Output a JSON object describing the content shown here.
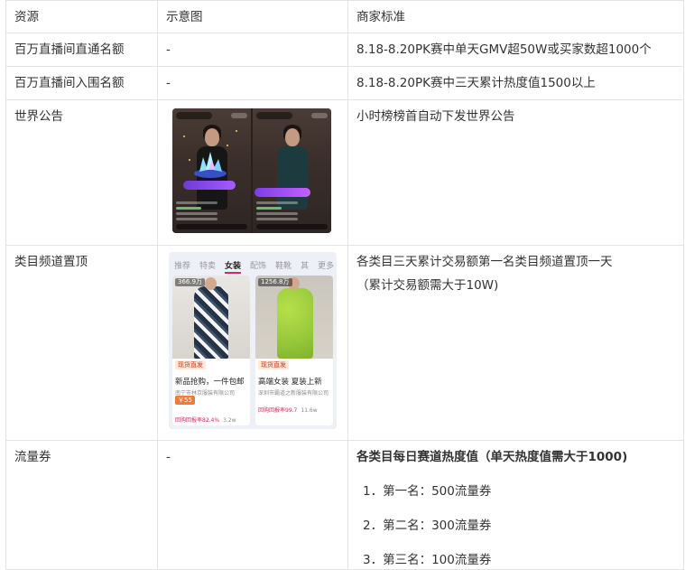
{
  "table": {
    "headers": [
      "资源",
      "示意图",
      "商家标准"
    ],
    "rows": [
      {
        "resource": "百万直播间直通名额",
        "image": "-",
        "standard": "8.18-8.20PK赛中单天GMV超50W或买家数超1000个"
      },
      {
        "resource": "百万直播间入围名额",
        "image": "-",
        "standard": "8.18-8.20PK赛中三天累计热度值1500以上"
      },
      {
        "resource": "世界公告",
        "image": "",
        "standard": "小时榜榜首自动下发世界公告"
      },
      {
        "resource": "类目频道置顶",
        "image": "",
        "standard": "各类目三天累计交易额第一名类目频道置顶一天",
        "standard_note": "（累计交易额需大于10W)"
      },
      {
        "resource": "流量券",
        "image": "-",
        "standard_title": "各类目每日赛道热度值（单天热度值需大于1000)",
        "list": [
          "1．第一名：500流量券",
          "2．第二名：300流量券",
          "3．第三名：100流量券"
        ]
      }
    ]
  },
  "category_mock": {
    "tabs": [
      "推荐",
      "特卖",
      "女装",
      "配饰",
      "鞋靴",
      "其",
      "更多"
    ],
    "active_tab": "女装",
    "cards": [
      {
        "title": "新品抢购，一件包邮",
        "shop": "南宁市林京服装有限公司",
        "badge": "现货直发",
        "price": "￥55",
        "metric": "回购回报率82.4%",
        "likes": "3.2w",
        "tag": "366.9万"
      },
      {
        "title": "高端女装 夏装上新",
        "shop": "深圳市霸道之新服装有限公司",
        "badge": "现货直发",
        "price": "",
        "metric": "回购回报率99.7",
        "likes": "11.6w",
        "tag": "1256.8万"
      }
    ]
  },
  "colors": {
    "border": "#e3e3e3",
    "text": "#333333",
    "accent": "#e0255b"
  }
}
